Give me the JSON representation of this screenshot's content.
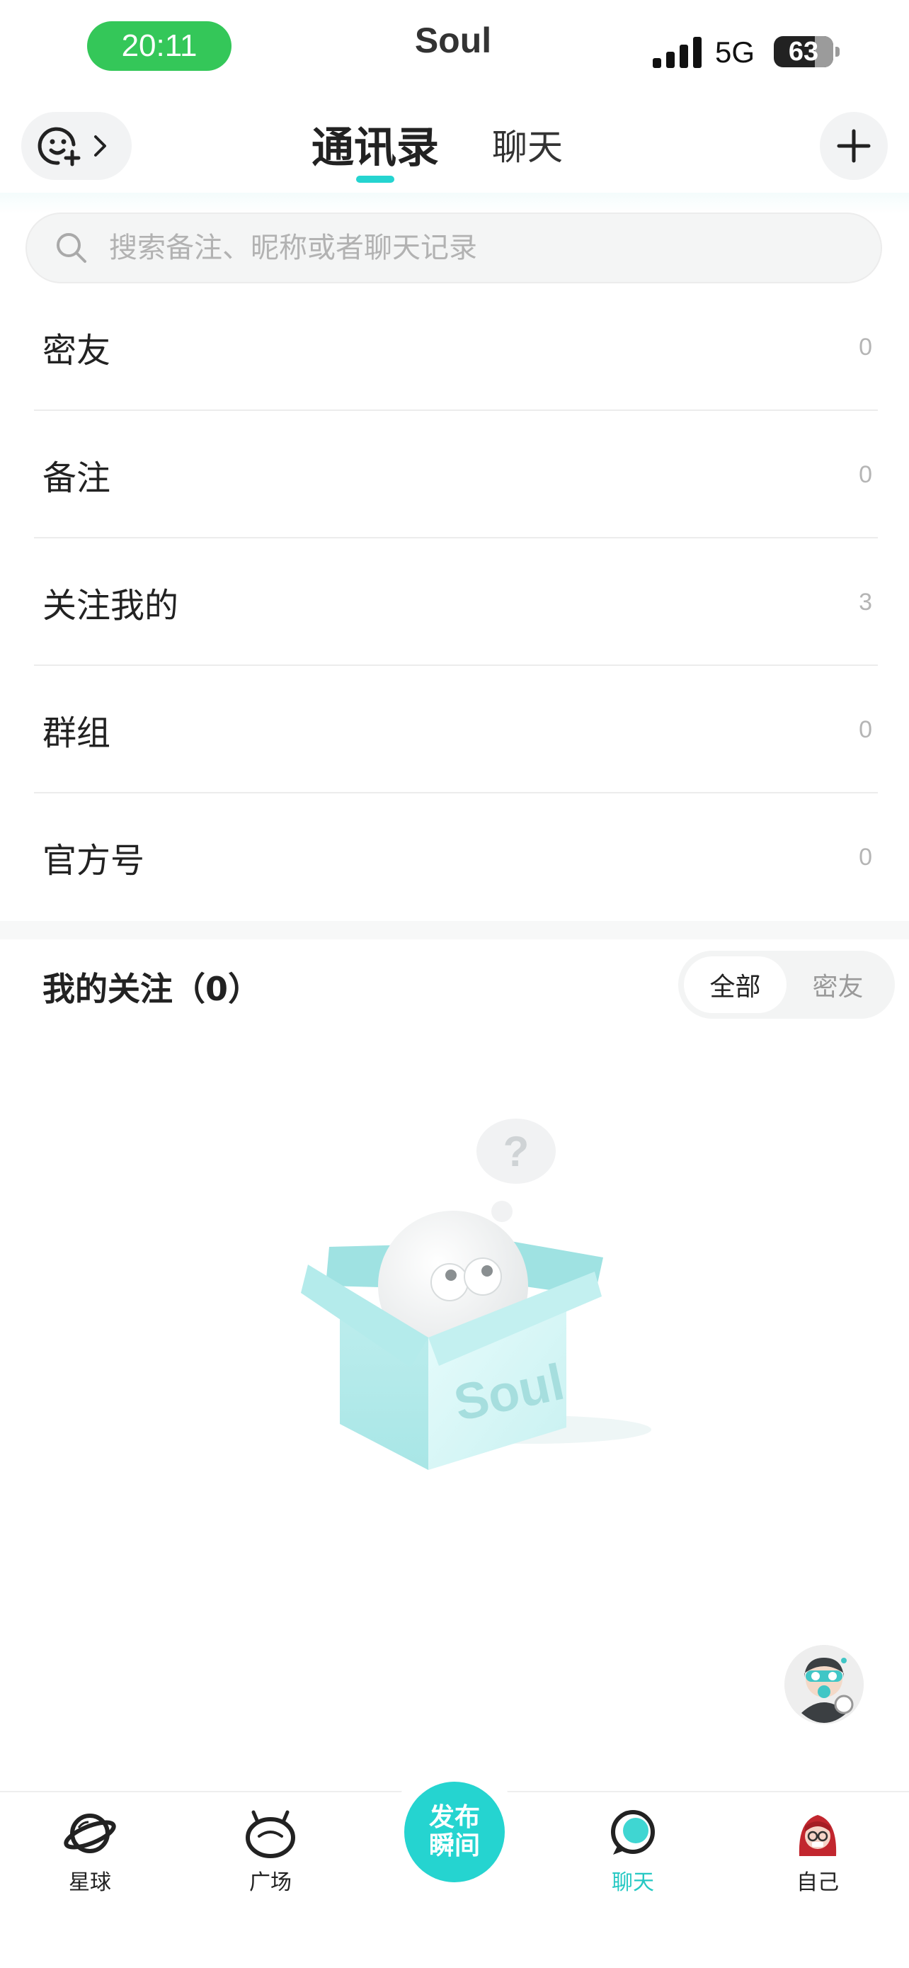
{
  "status_bar": {
    "time": "20:11",
    "app_name": "Soul",
    "network": "5G",
    "battery": "63"
  },
  "header": {
    "tabs": [
      {
        "label": "通讯录",
        "active": true
      },
      {
        "label": "聊天",
        "active": false
      }
    ],
    "add_icon": "plus-icon",
    "profile_icon": "smiley-plus-icon"
  },
  "search": {
    "placeholder": "搜索备注、昵称或者聊天记录"
  },
  "categories": [
    {
      "label": "密友",
      "count": "0"
    },
    {
      "label": "备注",
      "count": "0"
    },
    {
      "label": "关注我的",
      "count": "3"
    },
    {
      "label": "群组",
      "count": "0"
    },
    {
      "label": "官方号",
      "count": "0"
    }
  ],
  "following": {
    "title": "我的关注（0）",
    "filters": [
      "全部",
      "密友"
    ],
    "active_filter": "全部",
    "empty_art_text": "Soul"
  },
  "bottom_nav": {
    "items": [
      {
        "label": "星球",
        "icon": "planet-icon"
      },
      {
        "label": "广场",
        "icon": "square-face-icon"
      },
      {
        "label": "聊天",
        "icon": "chat-bubble-icon",
        "active": true
      },
      {
        "label": "自己",
        "icon": "avatar-icon"
      }
    ],
    "publish": [
      "发布",
      "瞬间"
    ]
  },
  "colors": {
    "accent": "#25d4d0",
    "time_pill": "#34c759"
  }
}
